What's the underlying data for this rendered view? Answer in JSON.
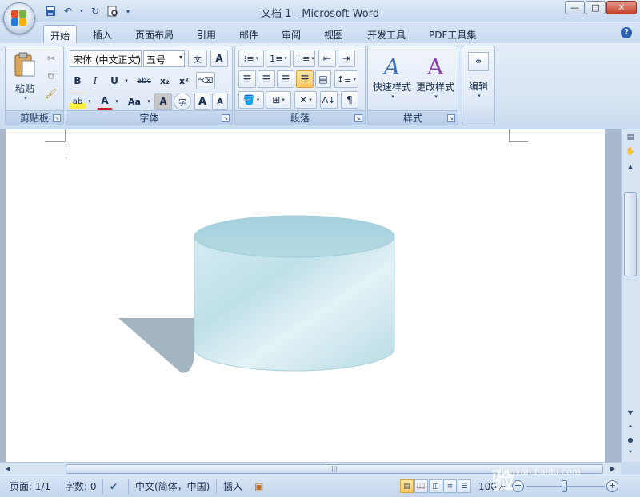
{
  "window": {
    "title": "文档 1 - Microsoft Word",
    "minimize_glyph": "—",
    "maximize_glyph": "□",
    "close_glyph": "✕"
  },
  "tabs": [
    {
      "label": "开始",
      "active": true
    },
    {
      "label": "插入"
    },
    {
      "label": "页面布局"
    },
    {
      "label": "引用"
    },
    {
      "label": "邮件"
    },
    {
      "label": "审阅"
    },
    {
      "label": "视图"
    },
    {
      "label": "开发工具"
    },
    {
      "label": "PDF工具集"
    }
  ],
  "help": "?",
  "ribbon": {
    "clipboard": {
      "label": "剪贴板",
      "paste_label": "粘贴"
    },
    "font": {
      "label": "字体",
      "font_name": "宋体 (中文正文)",
      "font_size": "五号",
      "bold": "B",
      "italic": "I",
      "underline": "U",
      "strike": "abc",
      "subscript": "x₂",
      "superscript": "x²",
      "highlight": "ab",
      "font_color": "A",
      "change_case": "Aa",
      "char_shading": "A",
      "enclose": "字",
      "grow": "A",
      "shrink": "A"
    },
    "paragraph": {
      "label": "段落"
    },
    "styles": {
      "label": "样式",
      "quick_styles": "快速样式",
      "change_styles": "更改样式"
    },
    "editing": {
      "label": "编辑"
    }
  },
  "document": {
    "shape": "cylinder",
    "colors": {
      "body_light": "#e6f3f7",
      "body_mid": "#bfe2ea",
      "top": "#a6d3df",
      "shadow": "#a0b3bf"
    }
  },
  "status": {
    "page": "页面: 1/1",
    "words": "字数: 0",
    "language": "中文(简体，中国)",
    "insert_mode": "插入",
    "zoom": "100%"
  },
  "watermark": {
    "brand": "Bai du 经验",
    "url": "jingyan.baidu.com"
  }
}
